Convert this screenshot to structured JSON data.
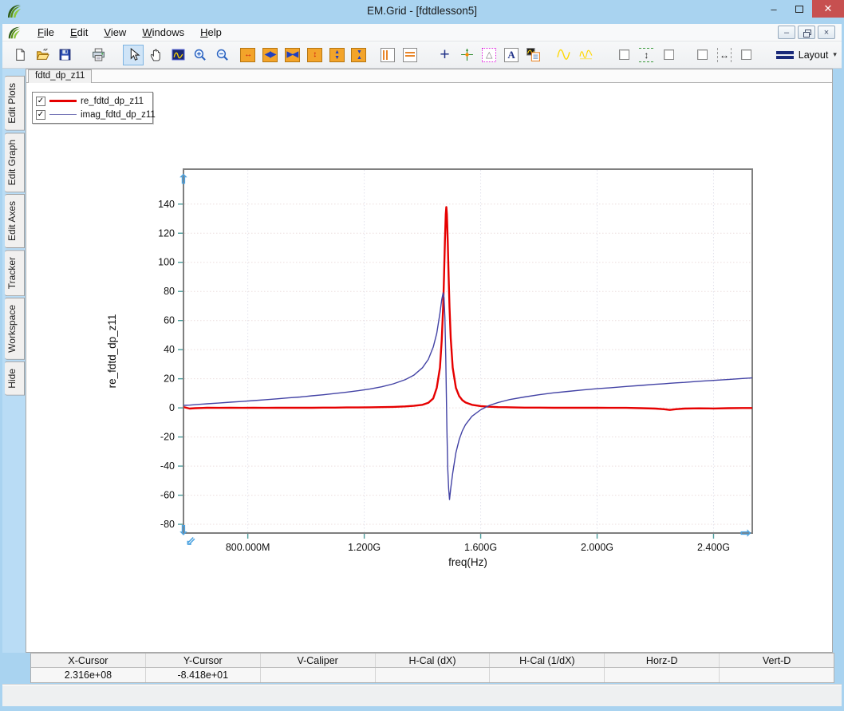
{
  "window": {
    "title": "EM.Grid - [fdtdlesson5]",
    "controls": {
      "minimize": "–",
      "close": "✕"
    }
  },
  "menubar": {
    "items": [
      {
        "label": "File"
      },
      {
        "label": "Edit"
      },
      {
        "label": "View"
      },
      {
        "label": "Windows"
      },
      {
        "label": "Help"
      }
    ],
    "mdi": {
      "minimize": "–",
      "close": "×"
    }
  },
  "toolbar": {
    "layout_label": "Layout",
    "layout_arrow": "▾",
    "buttons": [
      {
        "name": "new",
        "icon": "new"
      },
      {
        "name": "open",
        "icon": "open"
      },
      {
        "name": "save",
        "icon": "save"
      },
      {
        "name": "print",
        "icon": "print",
        "gap": 14
      },
      {
        "name": "select",
        "icon": "select",
        "gap": 16,
        "active": true
      },
      {
        "name": "pan",
        "icon": "hand"
      },
      {
        "name": "zoom-region",
        "icon": "zoom-region"
      },
      {
        "name": "zoom-in",
        "icon": "zoom-in"
      },
      {
        "name": "zoom-out",
        "icon": "zoom-out"
      },
      {
        "name": "expand-x",
        "icon": "orange",
        "glyph": "↔",
        "color": "#cc1111",
        "gap": 4
      },
      {
        "name": "pan-x",
        "icon": "orange",
        "glyph": "◀▶",
        "color": "#1f3fc0"
      },
      {
        "name": "shrink-x",
        "icon": "orange",
        "glyph": "▶◀",
        "color": "#1f3fc0"
      },
      {
        "name": "expand-y",
        "icon": "orange",
        "glyph": "↕",
        "color": "#cc1111"
      },
      {
        "name": "pan-y",
        "icon": "orange-v",
        "glyph": "▲▼",
        "color": "#1f3fc0"
      },
      {
        "name": "shrink-y",
        "icon": "orange-v",
        "glyph": "▼▲",
        "color": "#1f3fc0"
      },
      {
        "name": "left-scale",
        "icon": "stripes-v",
        "gap": 8
      },
      {
        "name": "top-scale",
        "icon": "stripes-h"
      },
      {
        "name": "crosshair",
        "icon": "plus",
        "glyph": "+",
        "gap": 16
      },
      {
        "name": "tracker",
        "icon": "tracker"
      },
      {
        "name": "caliper-triangle",
        "icon": "triangle",
        "glyph": "△"
      },
      {
        "name": "add-text",
        "icon": "textA",
        "glyph": "A"
      },
      {
        "name": "copy-plot",
        "icon": "copy"
      },
      {
        "name": "single-plot-style",
        "icon": "wave1",
        "gap": 10
      },
      {
        "name": "multi-plot-style",
        "icon": "wave2"
      },
      {
        "name": "v-caliper-check-left",
        "icon": "checkbox",
        "gap": 20
      },
      {
        "name": "v-caliper",
        "icon": "vcal",
        "glyph": "↕"
      },
      {
        "name": "v-caliper-check-right",
        "icon": "checkbox"
      },
      {
        "name": "h-caliper-check-left",
        "icon": "checkbox",
        "gap": 14
      },
      {
        "name": "h-caliper",
        "icon": "hcal",
        "glyph": "↔"
      },
      {
        "name": "h-caliper-check-right",
        "icon": "checkbox"
      }
    ]
  },
  "sidebar": {
    "tabs": [
      {
        "label": "Edit Plots"
      },
      {
        "label": "Edit Graph"
      },
      {
        "label": "Edit Axes"
      },
      {
        "label": "Tracker"
      },
      {
        "label": "Workspace"
      },
      {
        "label": "Hide"
      }
    ]
  },
  "tabs": [
    {
      "label": "fdtd_dp_z11"
    }
  ],
  "legend": {
    "items": [
      {
        "label": "re_fdtd_dp_z11",
        "color": "#e60000",
        "weight": 3,
        "checked": true
      },
      {
        "label": "imag_fdtd_dp_z11",
        "color": "#7878b8",
        "weight": 1.5,
        "checked": true
      }
    ]
  },
  "status": {
    "columns": [
      {
        "label": "X-Cursor",
        "value": "2.316e+08"
      },
      {
        "label": "Y-Cursor",
        "value": "-8.418e+01"
      },
      {
        "label": "V-Caliper",
        "value": ""
      },
      {
        "label": "H-Cal (dX)",
        "value": ""
      },
      {
        "label": "H-Cal (1/dX)",
        "value": ""
      },
      {
        "label": "Horz-D",
        "value": ""
      },
      {
        "label": "Vert-D",
        "value": ""
      }
    ]
  },
  "chart_data": {
    "type": "line",
    "title": "",
    "xlabel": "freq(Hz)",
    "ylabel": "re_fdtd_dp_z11",
    "x_unit": "MHz",
    "xlim": [
      579,
      2533
    ],
    "ylim": [
      -86,
      164
    ],
    "grid": true,
    "legend_position": "top-left",
    "x_ticks": [
      {
        "v": 800,
        "label": "800.000M"
      },
      {
        "v": 1200,
        "label": "1.200G"
      },
      {
        "v": 1600,
        "label": "1.600G"
      },
      {
        "v": 2000,
        "label": "2.000G"
      },
      {
        "v": 2400,
        "label": "2.400G"
      }
    ],
    "y_ticks": [
      -80,
      -60,
      -40,
      -20,
      0,
      20,
      40,
      60,
      80,
      100,
      120,
      140
    ],
    "x": [
      580,
      600,
      620,
      660,
      700,
      740,
      780,
      820,
      860,
      900,
      940,
      980,
      1020,
      1060,
      1100,
      1140,
      1180,
      1220,
      1260,
      1300,
      1340,
      1370,
      1400,
      1420,
      1437,
      1449,
      1460,
      1466,
      1471,
      1474,
      1477,
      1480,
      1482,
      1484,
      1487,
      1490,
      1493,
      1497,
      1504,
      1515,
      1526,
      1537,
      1548,
      1570,
      1600,
      1630,
      1660,
      1700,
      1750,
      1800,
      1850,
      1900,
      1950,
      2000,
      2050,
      2100,
      2150,
      2200,
      2230,
      2250,
      2270,
      2300,
      2350,
      2400,
      2450,
      2500,
      2533
    ],
    "series": [
      {
        "name": "re_fdtd_dp_z11",
        "color": "#e60000",
        "width": 2.4,
        "values": [
          0.5,
          -0.5,
          -0.2,
          0.1,
          0.0,
          0.1,
          0.0,
          0.1,
          0.0,
          0.1,
          0.1,
          0.1,
          0.1,
          0.2,
          0.2,
          0.3,
          0.3,
          0.4,
          0.5,
          0.7,
          1.0,
          1.4,
          2.1,
          3.5,
          6.5,
          13.8,
          27.6,
          46.2,
          69,
          90,
          114,
          133,
          138,
          133,
          114,
          90,
          69,
          48,
          27.6,
          13.8,
          8.1,
          5.3,
          3.7,
          2.1,
          1.2,
          0.8,
          0.5,
          0.4,
          0.2,
          0.2,
          0.1,
          0.1,
          0.1,
          0.1,
          0.0,
          0.0,
          -0.2,
          -0.5,
          -0.9,
          -1.4,
          -0.9,
          -0.5,
          -0.3,
          -0.4,
          -0.2,
          -0.1,
          -0.1
        ]
      },
      {
        "name": "imag_fdtd_dp_z11",
        "color": "#4343a5",
        "width": 1.4,
        "values": [
          1.7,
          1.9,
          2.2,
          2.8,
          3.3,
          3.9,
          4.4,
          5.0,
          5.6,
          6.2,
          6.9,
          7.5,
          8.3,
          9.0,
          9.9,
          10.8,
          11.8,
          13.0,
          14.5,
          16.5,
          19.3,
          22.4,
          27.6,
          33.3,
          41.8,
          51.2,
          65.1,
          74.2,
          79.1,
          75.7,
          62.2,
          34.5,
          10.2,
          -14.1,
          -41.9,
          -55.3,
          -63.0,
          -55.4,
          -44.8,
          -30.8,
          -21.8,
          -15.7,
          -11.5,
          -5.8,
          -1.3,
          1.7,
          3.7,
          5.7,
          7.5,
          9.0,
          10.3,
          11.3,
          12.3,
          13.2,
          13.9,
          14.7,
          15.4,
          16.2,
          16.6,
          16.9,
          17.2,
          17.5,
          18.3,
          18.9,
          19.5,
          20.2,
          20.6
        ]
      }
    ]
  }
}
